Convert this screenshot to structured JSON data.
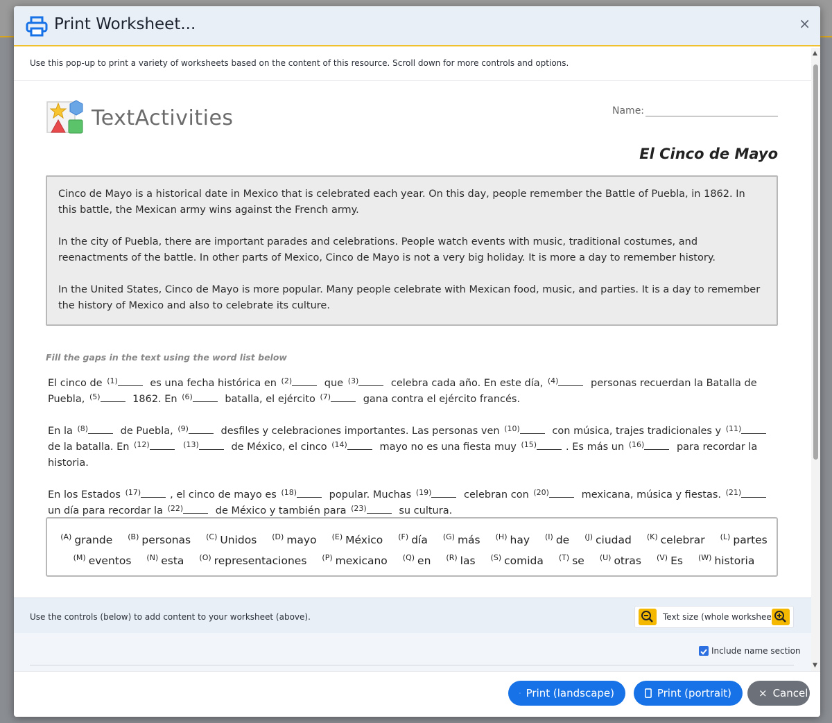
{
  "dialog": {
    "title": "Print Worksheet...",
    "close_label": "×",
    "intro": "Use this pop-up to print a variety of worksheets based on the content of this resource. Scroll down for more controls and options."
  },
  "worksheet": {
    "logo_text": "TextActivities",
    "name_label": "Name:",
    "title": "El Cinco de Mayo",
    "passage": [
      "Cinco de Mayo is a historical date in Mexico that is celebrated each year. On this day, people remember the Battle of Puebla, in 1862. In this battle, the Mexican army wins against the French army.",
      "In the city of Puebla, there are important parades and celebrations. People watch events with music, traditional costumes, and reenactments of the battle. In other parts of Mexico, Cinco de Mayo is not a very big holiday. It is more a day to remember history.",
      "In the United States, Cinco de Mayo is more popular. Many people celebrate with Mexican food, music, and parties. It is a day to remember the history of Mexico and also to celebrate its culture."
    ],
    "instructions": "Fill the gaps in the text using the word list below",
    "gap_paragraphs": [
      [
        {
          "t": "El cinco de "
        },
        {
          "n": "(1)"
        },
        {
          "t": " es una fecha histórica en "
        },
        {
          "n": "(2)"
        },
        {
          "t": " que "
        },
        {
          "n": "(3)"
        },
        {
          "t": " celebra cada año. En este día, "
        },
        {
          "n": "(4)"
        },
        {
          "t": " personas recuerdan la Batalla de Puebla, "
        },
        {
          "n": "(5)"
        },
        {
          "t": " 1862. En "
        },
        {
          "n": "(6)"
        },
        {
          "t": " batalla, el ejército "
        },
        {
          "n": "(7)"
        },
        {
          "t": " gana contra el ejército francés."
        }
      ],
      [
        {
          "t": "En la "
        },
        {
          "n": "(8)"
        },
        {
          "t": " de Puebla, "
        },
        {
          "n": "(9)"
        },
        {
          "t": " desfiles y celebraciones importantes. Las personas ven "
        },
        {
          "n": "(10)"
        },
        {
          "t": " con música, trajes tradicionales y "
        },
        {
          "n": "(11)"
        },
        {
          "t": " de la batalla. En "
        },
        {
          "n": "(12)"
        },
        {
          "t": " "
        },
        {
          "n": "(13)"
        },
        {
          "t": " de México, el cinco "
        },
        {
          "n": "(14)"
        },
        {
          "t": " mayo no es una fiesta muy "
        },
        {
          "n": "(15)"
        },
        {
          "t": ". Es más un "
        },
        {
          "n": "(16)"
        },
        {
          "t": " para recordar la historia."
        }
      ],
      [
        {
          "t": "En los Estados "
        },
        {
          "n": "(17)"
        },
        {
          "t": ", el cinco de mayo es "
        },
        {
          "n": "(18)"
        },
        {
          "t": " popular. Muchas "
        },
        {
          "n": "(19)"
        },
        {
          "t": " celebran con "
        },
        {
          "n": "(20)"
        },
        {
          "t": " mexicana, música y fiestas. "
        },
        {
          "n": "(21)"
        },
        {
          "t": " un día para recordar la "
        },
        {
          "n": "(22)"
        },
        {
          "t": " de México y también para "
        },
        {
          "n": "(23)"
        },
        {
          "t": " su cultura."
        }
      ]
    ],
    "word_list": [
      [
        {
          "letter": "(A)",
          "word": "grande"
        },
        {
          "letter": "(B)",
          "word": "personas"
        },
        {
          "letter": "(C)",
          "word": "Unidos"
        },
        {
          "letter": "(D)",
          "word": "mayo"
        },
        {
          "letter": "(E)",
          "word": "México"
        },
        {
          "letter": "(F)",
          "word": "día"
        },
        {
          "letter": "(G)",
          "word": "más"
        },
        {
          "letter": "(H)",
          "word": "hay"
        },
        {
          "letter": "(I)",
          "word": "de"
        },
        {
          "letter": "(J)",
          "word": "ciudad"
        },
        {
          "letter": "(K)",
          "word": "celebrar"
        },
        {
          "letter": "(L)",
          "word": "partes"
        }
      ],
      [
        {
          "letter": "(M)",
          "word": "eventos"
        },
        {
          "letter": "(N)",
          "word": "esta"
        },
        {
          "letter": "(O)",
          "word": "representaciones"
        },
        {
          "letter": "(P)",
          "word": "mexicano"
        },
        {
          "letter": "(Q)",
          "word": "en"
        },
        {
          "letter": "(R)",
          "word": "las"
        },
        {
          "letter": "(S)",
          "word": "comida"
        },
        {
          "letter": "(T)",
          "word": "se"
        },
        {
          "letter": "(U)",
          "word": "otras"
        },
        {
          "letter": "(V)",
          "word": "Es"
        },
        {
          "letter": "(W)",
          "word": "historia"
        }
      ]
    ]
  },
  "controls": {
    "instructions": "Use the controls (below) to add content to your worksheet (above).",
    "text_size_label": "Text size (whole worksheet)",
    "include_name_label": "Include name section",
    "include_name_checked": true
  },
  "footer": {
    "print_landscape": "Print (landscape)",
    "print_portrait": "Print (portrait)",
    "cancel": "Cancel"
  },
  "colors": {
    "accent": "#1672e6",
    "header_rule": "#f0c02f",
    "zoom": "#f5b800"
  }
}
